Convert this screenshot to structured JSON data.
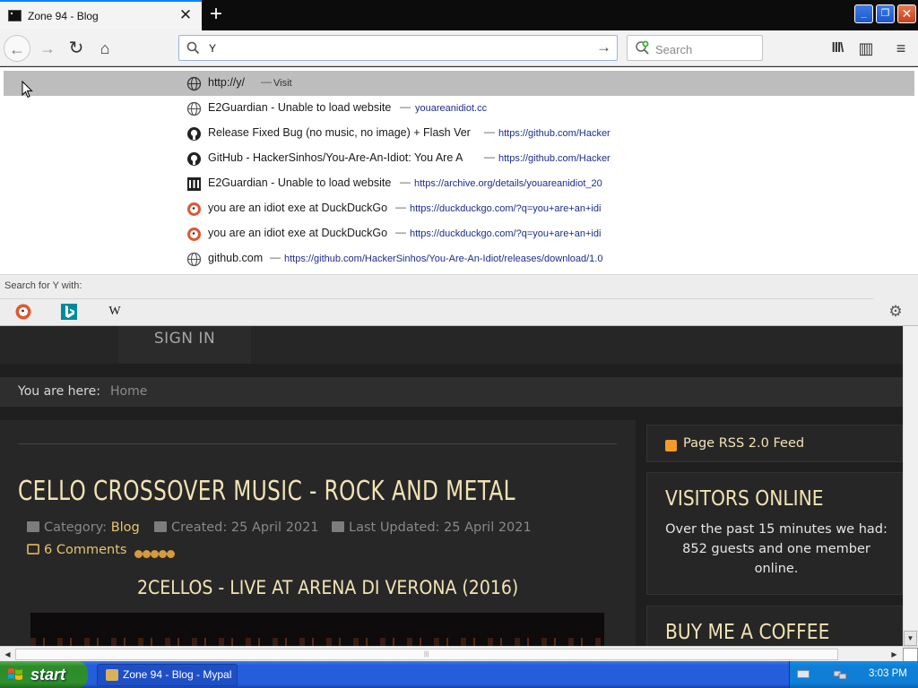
{
  "browser": {
    "tab_title": "Zone 94 - Blog",
    "tab_close": "✕",
    "new_tab": "+",
    "window_controls": {
      "minimize": "_",
      "maximize": "❐",
      "close": "✕"
    }
  },
  "toolbar": {
    "url_value": "Y",
    "search_placeholder": "Search",
    "icons": {
      "back": "←",
      "forward": "→",
      "reload": "↻",
      "home": "⌂",
      "go": "→",
      "library": "lll\\",
      "sidebar": "▥",
      "menu": "≡"
    }
  },
  "dropdown": {
    "suggestions": [
      {
        "icon": "globe",
        "title": "http://y/",
        "sep": "—",
        "url": "Visit"
      },
      {
        "icon": "globe",
        "title": "E2Guardian - Unable to load website",
        "sep": "—",
        "url": "youareanidiot.cc"
      },
      {
        "icon": "github",
        "title": "Release Fixed Bug (no music, no image) + Flash Ver",
        "sep": "—",
        "url": "https://github.com/Hacker"
      },
      {
        "icon": "github",
        "title": "GitHub - HackerSinhos/You-Are-An-Idiot: You Are A",
        "sep": "—",
        "url": "https://github.com/Hacker"
      },
      {
        "icon": "archive",
        "title": "E2Guardian - Unable to load website",
        "sep": "—",
        "url": "https://archive.org/details/youareanidiot_20"
      },
      {
        "icon": "duckduckgo",
        "title": "you are an idiot exe at DuckDuckGo",
        "sep": "—",
        "url": "https://duckduckgo.com/?q=you+are+an+idi"
      },
      {
        "icon": "duckduckgo",
        "title": "you are an idiot exe at DuckDuckGo",
        "sep": "—",
        "url": "https://duckduckgo.com/?q=you+are+an+idi"
      },
      {
        "icon": "globe",
        "title": "github.com",
        "sep": "—",
        "url": "https://github.com/HackerSinhos/You-Are-An-Idiot/releases/download/1.0"
      }
    ],
    "search_with_label": "Search for Y with:",
    "engines": {
      "wikipedia": "W",
      "settings": "⚙"
    }
  },
  "page": {
    "signin": "SIGN IN",
    "breadcrumb_label": "You are here:",
    "breadcrumb_home": "Home",
    "article_title": "CELLO CROSSOVER MUSIC - ROCK AND METAL",
    "category_label": "Category:",
    "category_value": "Blog",
    "created": "Created: 25 April 2021",
    "updated": "Last Updated: 25 April 2021",
    "comments": "6 Comments",
    "rating_stars": 5,
    "video_title": "2CELLOS - LIVE AT ARENA DI VERONA (2016)",
    "rss_link": "Page RSS 2.0 Feed",
    "visitors_title": "VISITORS ONLINE",
    "visitors_text": "Over the past 15 minutes we had: 852 guests and one member online.",
    "coffee_title": "BUY ME A COFFEE"
  },
  "taskbar": {
    "start": "start",
    "task_item": "Zone 94 - Blog - Mypal",
    "clock": "3:03 PM"
  },
  "colors": {
    "accent_tab": "#0a84ff",
    "page_heading": "#f2e3b4",
    "page_link": "#e8c46c",
    "taskbar_blue": "#245edb",
    "start_green": "#2e8b2a"
  }
}
